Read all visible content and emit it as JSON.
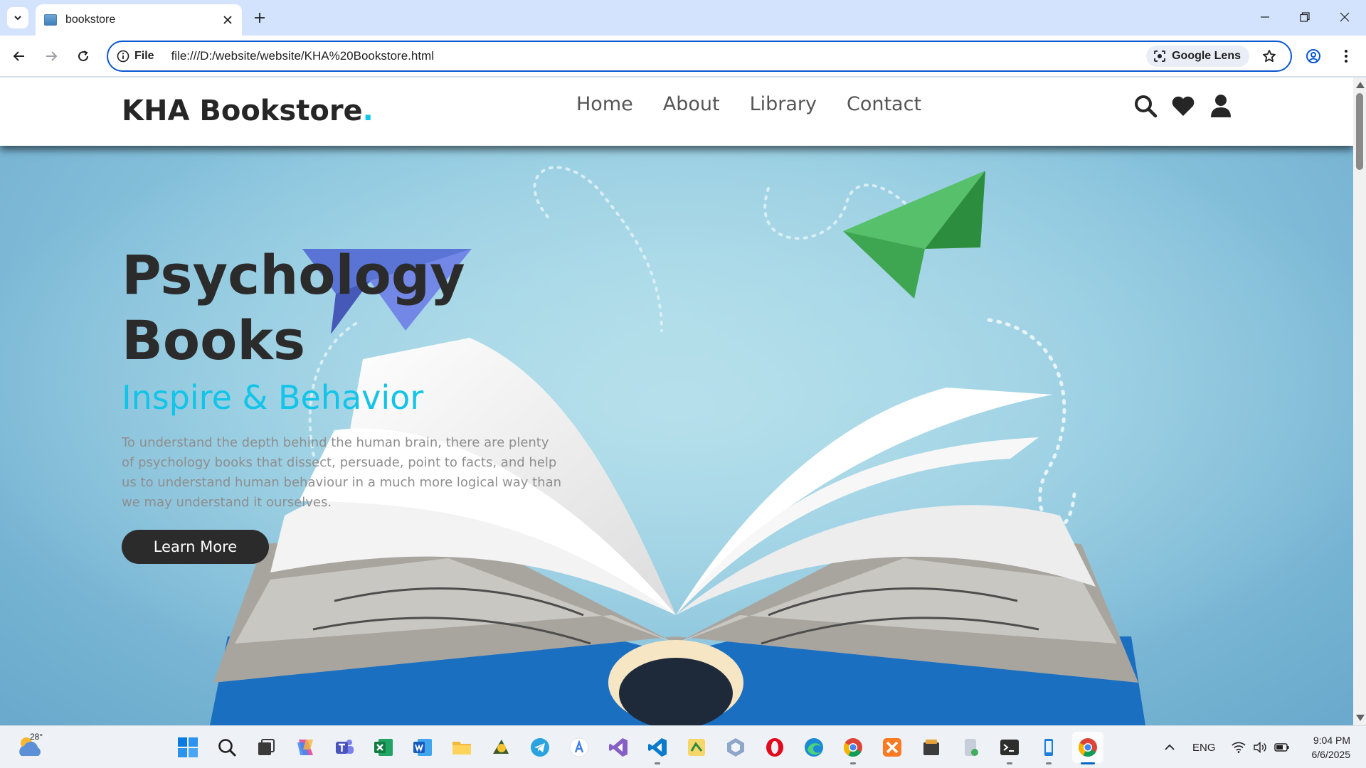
{
  "browser": {
    "tab_title": "bookstore",
    "address_chip": "File",
    "url": "file:///D:/website/website/KHA%20Bookstore.html",
    "lens_label": "Google Lens"
  },
  "site": {
    "logo_text": "KHA Bookstore",
    "logo_dot": ".",
    "nav": [
      "Home",
      "About",
      "Library",
      "Contact"
    ],
    "header_icons": [
      "search-icon",
      "heart-icon",
      "user-icon"
    ],
    "accent_color": "#12c4e8"
  },
  "hero": {
    "title_line1": "Psychology",
    "title_line2": "Books",
    "subtitle": "Inspire & Behavior",
    "text": "To understand the depth behind the human brain, there are plenty of psychology books that dissect, persuade, point to facts, and help us to understand human behaviour in a much more logical way than we may understand it ourselves.",
    "button": "Learn More"
  },
  "taskbar": {
    "weather_temp": "28°",
    "apps": [
      "start-icon",
      "search-icon",
      "task-view-icon",
      "copilot-icon",
      "teams-icon",
      "excel-icon",
      "word-icon",
      "file-explorer-icon",
      "app-icon",
      "telegram-icon",
      "app-store-icon",
      "visual-studio-icon",
      "vscode-icon",
      "app-icon",
      "app-icon",
      "opera-icon",
      "edge-icon",
      "chrome-icon",
      "xampp-icon",
      "app-icon",
      "app-icon",
      "terminal-icon",
      "app-icon",
      "chrome-active-icon"
    ],
    "language": "ENG",
    "time": "9:04 PM",
    "date": "6/6/2025"
  }
}
